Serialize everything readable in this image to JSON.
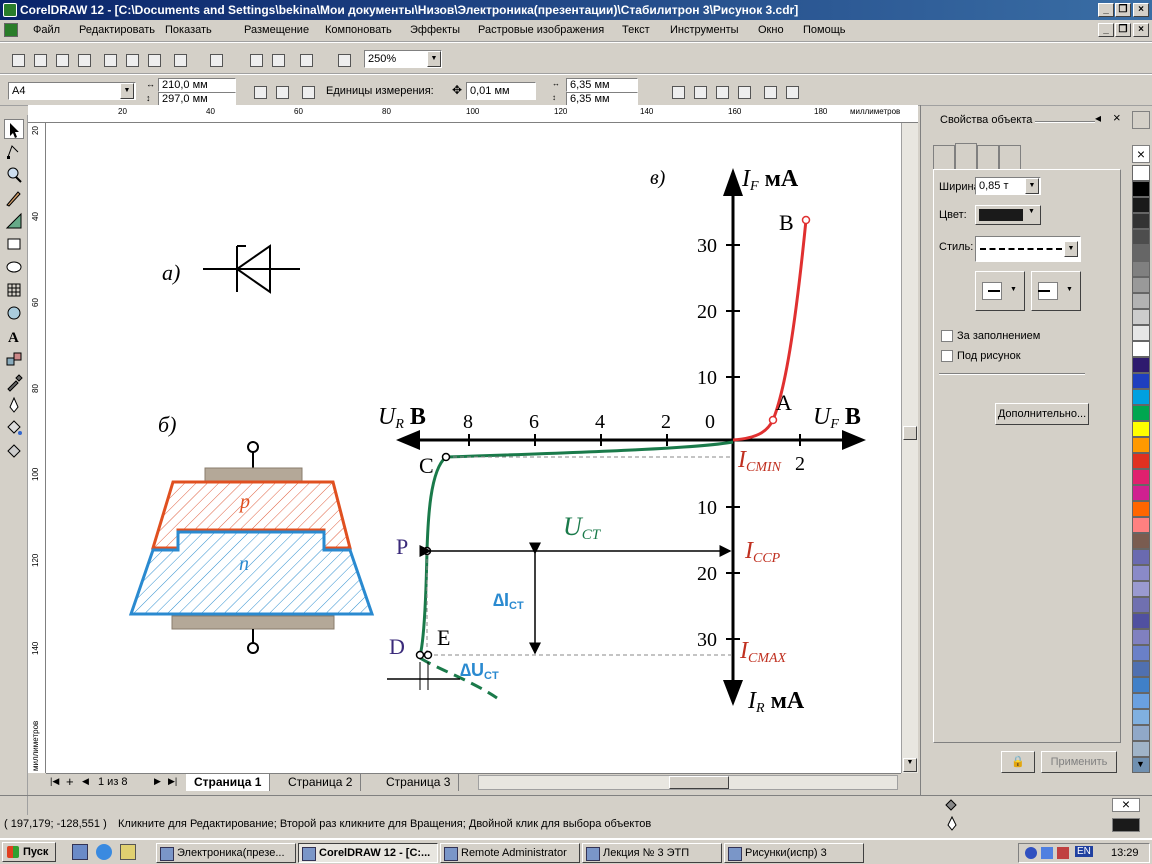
{
  "window": {
    "title": "CorelDRAW 12 - [C:\\Documents and Settings\\bekina\\Мои документы\\Низов\\Электроника(презентации)\\Стабилитрон 3\\Рисунок 3.cdr]"
  },
  "menu": [
    "Файл",
    "Редактировать",
    "Показать",
    "Размещение",
    "Компоновать",
    "Эффекты",
    "Растровые изображения",
    "Текст",
    "Инструменты",
    "Окно",
    "Помощь"
  ],
  "standard_toolbar": {
    "zoom": "250%"
  },
  "property_bar": {
    "paper": "A4",
    "width": "210,0 мм",
    "height": "297,0 мм",
    "units_label": "Единицы измерения:",
    "nudge": "0,01 мм",
    "dup_x": "6,35 мм",
    "dup_y": "6,35 мм"
  },
  "ruler": {
    "top_ticks": [
      "20",
      "40",
      "60",
      "80",
      "100",
      "120",
      "140",
      "160",
      "180"
    ],
    "top_unit": "миллиметров",
    "left_ticks": [
      "20",
      "40",
      "60",
      "80",
      "100",
      "120",
      "140"
    ],
    "left_unit": "миллиметров"
  },
  "drawing": {
    "label_a": "а)",
    "label_b": "б)",
    "label_v": "в)",
    "p_label": "p",
    "n_label": "n",
    "y_pos_axis": "IF, мА",
    "y_neg_axis": "IR, мА",
    "x_pos_axis": "UF, В",
    "x_neg_axis": "UR, В",
    "y_pos_ticks": [
      "10",
      "20",
      "30"
    ],
    "y_neg_ticks": [
      "10",
      "20",
      "30"
    ],
    "x_neg_ticks": [
      "8",
      "6",
      "4",
      "2",
      "0"
    ],
    "x_pos_ticks": [
      "2"
    ],
    "points": {
      "B": "B",
      "A": "A",
      "C": "C",
      "P": "P",
      "D": "D",
      "E": "E"
    },
    "i_cmin": "I",
    "i_cmin_sub": "CMIN",
    "i_ccp": "I",
    "i_ccp_sub": "CCP",
    "i_cmax": "I",
    "i_cmax_sub": "CMAX",
    "u_ct": "U",
    "u_ct_sub": "CT",
    "delta_i": "∆I",
    "delta_i_sub": "CT",
    "delta_u": "∆U",
    "delta_u_sub": "CT",
    "sub_F": "F",
    "sub_R": "R",
    "unit_ma": "мА",
    "unit_v": "В"
  },
  "pages": {
    "counter": "1 из 8",
    "tabs": [
      "Страница 1",
      "Страница 2",
      "Страница 3"
    ]
  },
  "docker": {
    "title": "Свойства объекта",
    "width_label": "Ширина:",
    "width_value": "0,85 т",
    "color_label": "Цвет:",
    "style_label": "Стиль:",
    "behind_fill": "За заполнением",
    "scale_image": "Под рисунок",
    "advanced": "Дополнительно...",
    "apply": "Применить"
  },
  "palette_colors": [
    "#ffffff",
    "#000000",
    "#1a1a1a",
    "#333333",
    "#4d4d4d",
    "#666666",
    "#808080",
    "#999999",
    "#b3b3b3",
    "#cccccc",
    "#e6e6e6",
    "#ffffff",
    "#2e1a6e",
    "#1f3fbf",
    "#00a0e0",
    "#00a650",
    "#ffff00",
    "#ff9900",
    "#e03020",
    "#e0206e",
    "#d02090",
    "#ff6600",
    "#ff8080",
    "#7a5c50",
    "#6a6ab0",
    "#8a8ac8",
    "#9a9ad0",
    "#7070b0",
    "#5050a0",
    "#8080c0",
    "#6a80c8",
    "#5070b0",
    "#4080c8",
    "#6aa0e0",
    "#80b0e0",
    "#90a8c8",
    "#a0b4c8",
    "#7090b0"
  ],
  "status": {
    "coords": "( 197,179; -128,551 )",
    "message": "Кликните для Редактирование; Второй раз кликните для Вращения; Двойной клик для выбора объектов"
  },
  "taskbar": {
    "start": "Пуск",
    "tasks": [
      "Электроника(презе...",
      "CorelDRAW 12 - [C:...",
      "Remote Administrator",
      "Лекция № 3 ЭТП",
      "Рисунки(испр) 3"
    ],
    "lang": "EN",
    "clock": "13:29"
  }
}
